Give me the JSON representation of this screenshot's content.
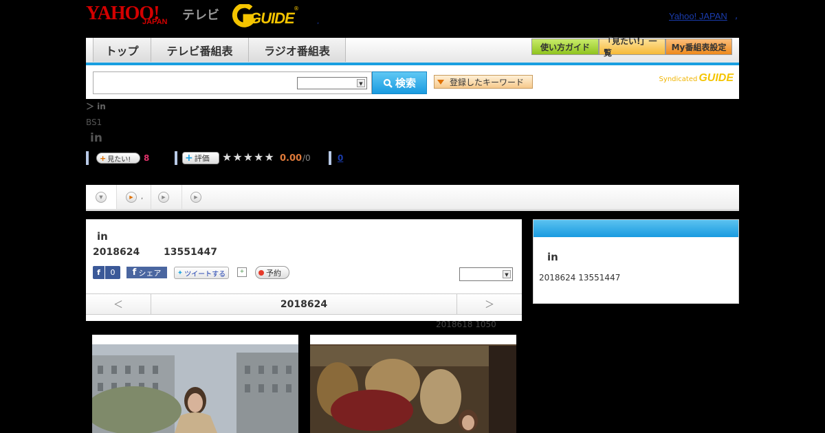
{
  "header": {
    "logo_yahoo": "YAHOO!",
    "logo_japan": "JAPAN",
    "logo_tv": "テレビ",
    "logo_gguide": "GUIDE",
    "logo_reg": "®",
    "dot": ",",
    "yahoo_japan_link": "Yahoo! JAPAN",
    "comma": ","
  },
  "nav": {
    "tabs": [
      "トップ",
      "テレビ番組表",
      "ラジオ番組表"
    ],
    "right_buttons": [
      "使い方ガイド",
      "「見たい!」一覧",
      "My番組表設定"
    ]
  },
  "search": {
    "input_value": "",
    "select_value": "",
    "button_label": "検索",
    "keyword_button": "登録したキーワード",
    "syndicated_label": "Syndicated",
    "syndicated_logo": "GUIDE"
  },
  "breadcrumb": "＞ in",
  "channel": "BS1",
  "program_title": "in",
  "meta": {
    "mitai_label": "見たい!",
    "mitai_count": "8",
    "hyoka_label": "評価",
    "stars": "★★★★★",
    "score": "0.00",
    "score_den": "/0",
    "count_link": "0"
  },
  "subtabs": [
    {
      "label": ""
    },
    {
      "label": ","
    },
    {
      "label": ""
    },
    {
      "label": ""
    }
  ],
  "detail": {
    "title": "in",
    "date": "2018624",
    "time": "13551447",
    "fb_like": "f",
    "fb_like_count": "0",
    "fb_share": "シェア",
    "tweet": "ツイートする",
    "reserve": "予約",
    "select_value": "",
    "nav_prev": "＜",
    "nav_date": "2018624",
    "nav_next": "＞",
    "update_note": "2018618  1050"
  },
  "side": {
    "title": "in",
    "info": "2018624  13551447"
  }
}
